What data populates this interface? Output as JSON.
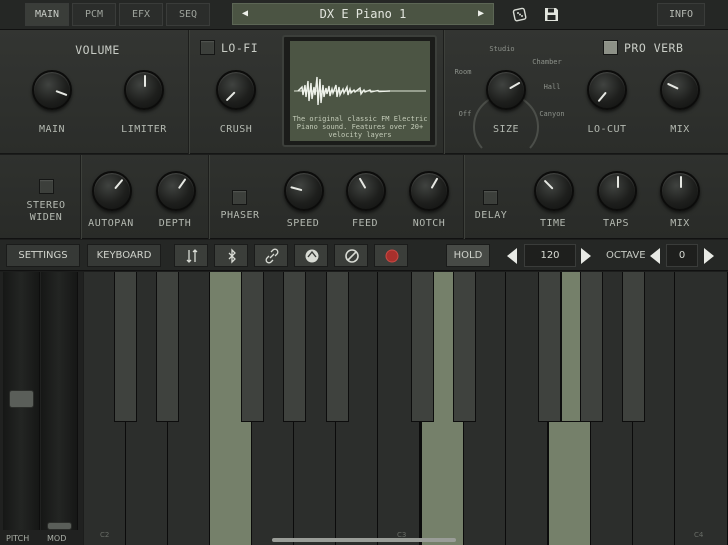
{
  "tabs": [
    "MAIN",
    "PCM",
    "EFX",
    "SEQ"
  ],
  "preset": {
    "name": "DX E Piano 1",
    "prev": "◀",
    "next": "▶"
  },
  "info_label": "INFO",
  "synth": {
    "volume_label": "VOLUME",
    "main_label": "MAIN",
    "limiter_label": "LIMITER",
    "lofi_label": "LO-FI",
    "crush_label": "CRUSH",
    "description": "The original classic FM Electric Piano sound. Features over 20+ velocity layers",
    "proverb_label": "PRO VERB",
    "size_label": "SIZE",
    "rooms": [
      "Studio",
      "Chamber",
      "Room",
      "Hall",
      "Off",
      "Canyon"
    ],
    "locut_label": "LO-CUT",
    "mix_label": "MIX"
  },
  "fx": {
    "stereo_label": "STEREO",
    "widen_label": "WIDEN",
    "autopan_label": "AUTOPAN",
    "depth_label": "DEPTH",
    "phaser_label": "PHASER",
    "speed_label": "SPEED",
    "feed_label": "FEED",
    "notch_label": "NOTCH",
    "delay_label": "DELAY",
    "time_label": "TIME",
    "taps_label": "TAPS",
    "mix_label": "MIX"
  },
  "toolbar": {
    "settings": "SETTINGS",
    "keyboard": "KEYBOARD",
    "hold": "HOLD",
    "bpm": "120",
    "octave_label": "OCTAVE",
    "octave": "0"
  },
  "wheels": {
    "pitch": "PITCH",
    "mod": "MOD"
  },
  "keys": {
    "c2": "C2",
    "c3": "C3",
    "c4": "C4"
  },
  "colors": {
    "lcd": "#4c5544",
    "lit_key": "#75806a",
    "record": "#a8302c"
  }
}
